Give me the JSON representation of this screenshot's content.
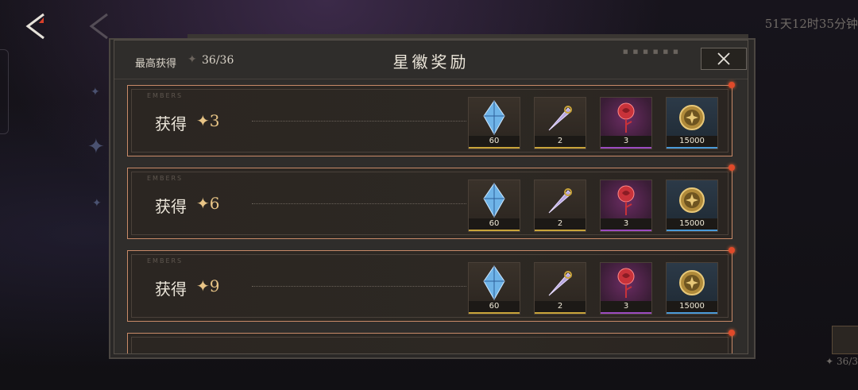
{
  "timer": "51天12时35分钟",
  "right_counter": "✦ 36/3",
  "panel": {
    "title": "星徽奖励",
    "best_label": "最高获得",
    "best_star": "✦",
    "best_count": "36/36",
    "close_label": "close",
    "embers_text": "EMBERS"
  },
  "rows": [
    {
      "label": "获得",
      "stars": "✦3",
      "items": [
        {
          "icon": "blue-crystal-icon",
          "qty": "60"
        },
        {
          "icon": "spear-shard-icon",
          "qty": "2"
        },
        {
          "icon": "red-rose-icon",
          "qty": "3"
        },
        {
          "icon": "gold-coin-icon",
          "qty": "15000"
        }
      ]
    },
    {
      "label": "获得",
      "stars": "✦6",
      "items": [
        {
          "icon": "blue-crystal-icon",
          "qty": "60"
        },
        {
          "icon": "spear-shard-icon",
          "qty": "2"
        },
        {
          "icon": "red-rose-icon",
          "qty": "3"
        },
        {
          "icon": "gold-coin-icon",
          "qty": "15000"
        }
      ]
    },
    {
      "label": "获得",
      "stars": "✦9",
      "items": [
        {
          "icon": "blue-crystal-icon",
          "qty": "60"
        },
        {
          "icon": "spear-shard-icon",
          "qty": "2"
        },
        {
          "icon": "red-rose-icon",
          "qty": "3"
        },
        {
          "icon": "gold-coin-icon",
          "qty": "15000"
        }
      ]
    }
  ],
  "colors": {
    "accent_gold": "#e8c486",
    "row_border": "#c88a68",
    "notify_dot": "#e04a2a"
  }
}
